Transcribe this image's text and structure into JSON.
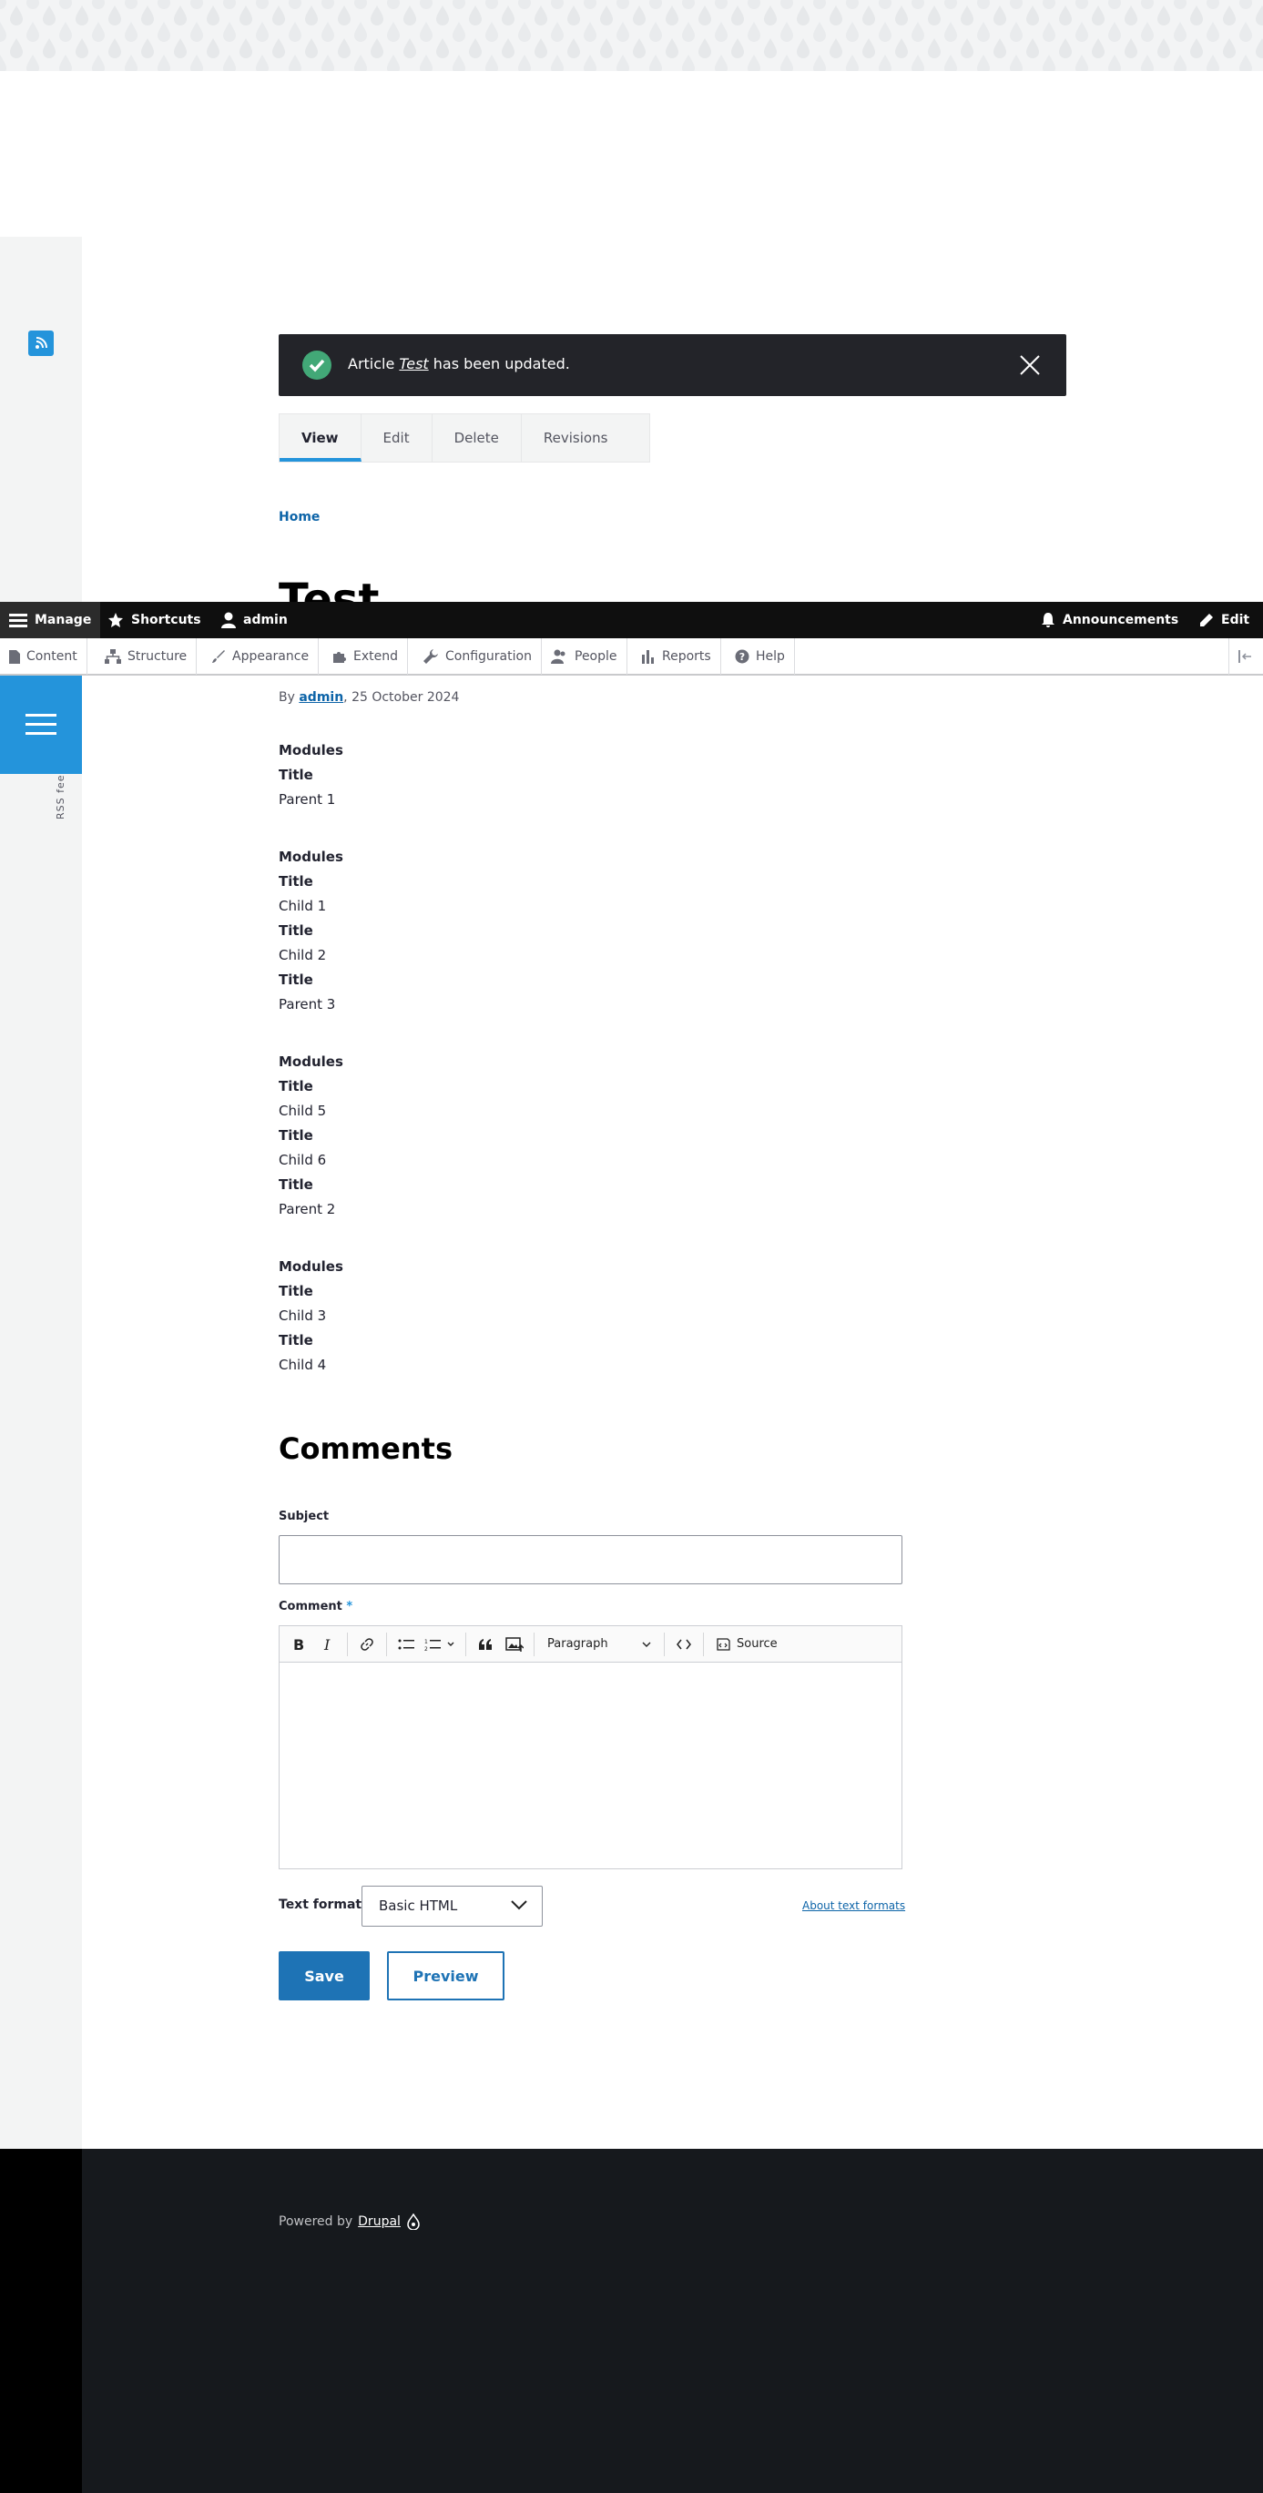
{
  "rss": {
    "label": "RSS feed"
  },
  "message": {
    "prefix": "Article ",
    "title": "Test",
    "suffix": " has been updated."
  },
  "tabs": [
    {
      "label": "View"
    },
    {
      "label": "Edit"
    },
    {
      "label": "Delete"
    },
    {
      "label": "Revisions"
    }
  ],
  "breadcrumb": {
    "home": "Home"
  },
  "page": {
    "title": "Test"
  },
  "toolbar": {
    "manage": "Manage",
    "shortcuts": "Shortcuts",
    "user": "admin",
    "announcements": "Announcements",
    "edit": "Edit"
  },
  "tray": [
    {
      "label": "Content"
    },
    {
      "label": "Structure"
    },
    {
      "label": "Appearance"
    },
    {
      "label": "Extend"
    },
    {
      "label": "Configuration"
    },
    {
      "label": "People"
    },
    {
      "label": "Reports"
    },
    {
      "label": "Help"
    }
  ],
  "byline": {
    "by": "By ",
    "author": "admin",
    "date": ", 25 October 2024"
  },
  "content": {
    "lines": [
      "Modules",
      "Title",
      "Parent 1",
      "Modules",
      "Title",
      "Child 1",
      "Title",
      "Child 2",
      "Title",
      "Parent 3",
      "Modules",
      "Title",
      "Child 5",
      "Title",
      "Child 6",
      "Title",
      "Parent 2",
      "Modules",
      "Title",
      "Child 3",
      "Title",
      "Child 4"
    ]
  },
  "comments": {
    "heading": "Comments",
    "subject_label": "Subject",
    "subject_value": "",
    "comment_label": "Comment",
    "required_mark": "*",
    "paragraph": "Paragraph",
    "source": "Source",
    "text_format_label": "Text format",
    "text_format_value": "Basic HTML",
    "about_link": "About text formats",
    "save": "Save",
    "preview": "Preview"
  },
  "footer": {
    "powered_by": "Powered by",
    "drupal": "Drupal"
  },
  "colors": {
    "accent": "#2494db",
    "toolbar": "#0f0f0f",
    "primary_button": "#1e73b5",
    "success": "#42a877"
  }
}
